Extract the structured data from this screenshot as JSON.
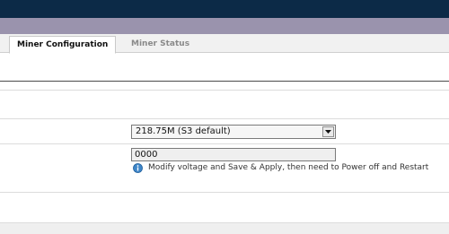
{
  "tabs": [
    {
      "label": "Miner Configuration",
      "active": true
    },
    {
      "label": "Miner Status",
      "active": false
    }
  ],
  "frequency_select": {
    "selected": "218.75M (S3 default)"
  },
  "voltage_input": {
    "value": "0000"
  },
  "hint": {
    "icon": "info-icon",
    "text": "Modify voltage and Save & Apply, then need to Power off and Restart"
  },
  "colors": {
    "topbar": "#0c2a47",
    "band": "#9a93ad",
    "tabbar": "#f1f1f1",
    "info_icon": "#3f86c8"
  }
}
